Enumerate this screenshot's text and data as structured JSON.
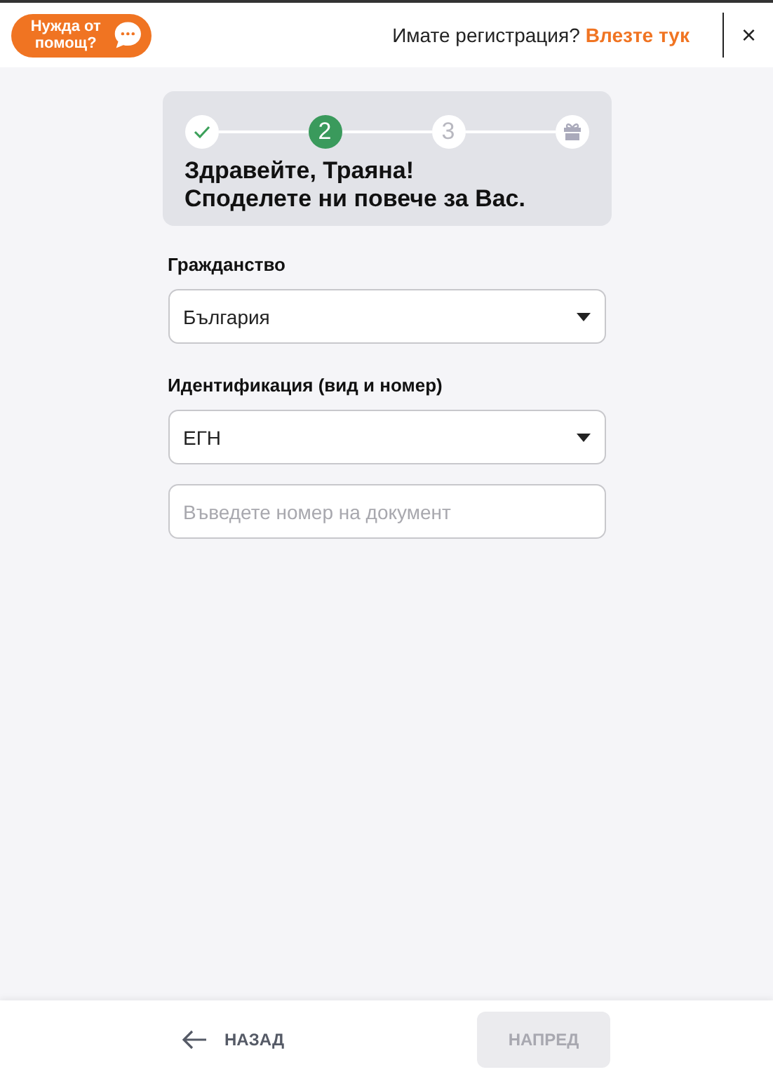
{
  "header": {
    "help_button": "Нужда от помощ?",
    "prompt": "Имате регистрация?",
    "login_link": "Влезте тук",
    "close": "×"
  },
  "steps": [
    {
      "kind": "done"
    },
    {
      "kind": "current",
      "label": "2"
    },
    {
      "kind": "upcoming",
      "label": "3"
    },
    {
      "kind": "reward"
    }
  ],
  "heading": [
    "Здравейте, Траяна!",
    "Споделете ни повече за Вас."
  ],
  "fields": [
    {
      "label": "Гражданство",
      "kind": "select",
      "value": "България"
    },
    {
      "label": "Идентификация (вид и номер)",
      "kind": "select",
      "value": "ЕГН"
    },
    {
      "kind": "input",
      "placeholder": "Въведете номер на документ"
    }
  ],
  "footer": {
    "back": "НАЗАД",
    "next": {
      "label": "НАПРЕД",
      "disabled": true
    }
  }
}
